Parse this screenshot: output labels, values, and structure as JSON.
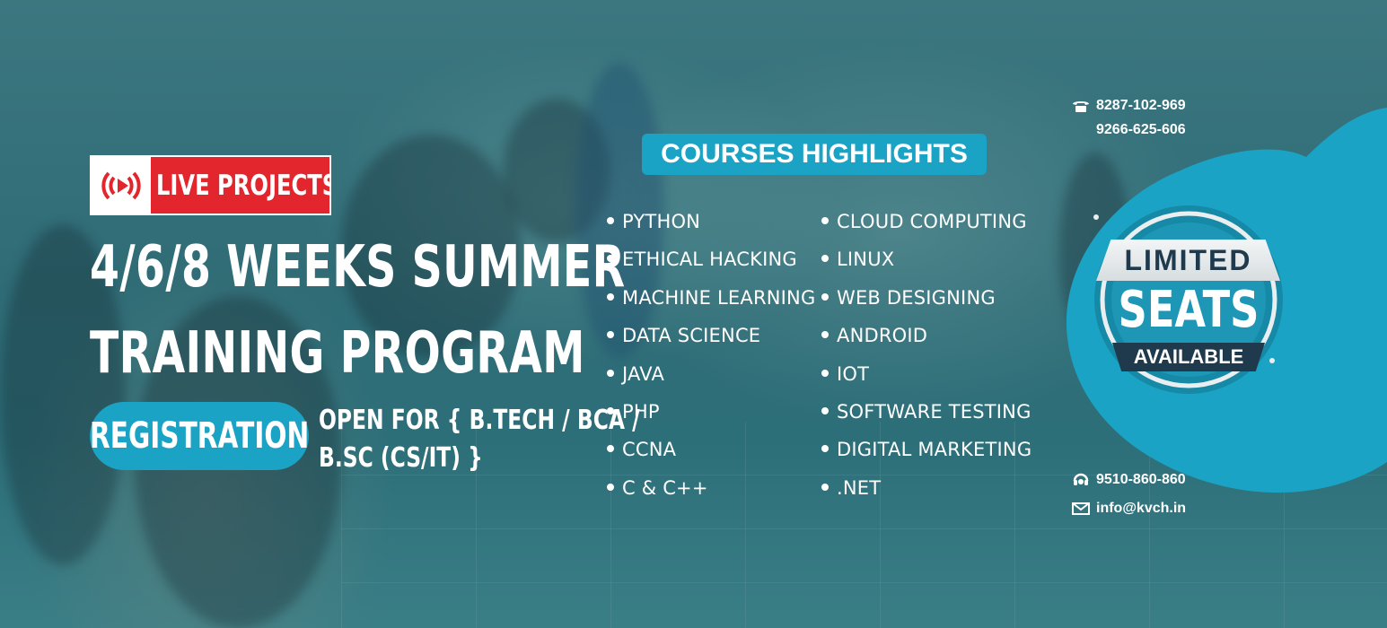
{
  "badge": {
    "label": "LIVE PROJECTS"
  },
  "headline": {
    "line1": "4/6/8 WEEKS SUMMER",
    "line2": "TRAINING PROGRAM"
  },
  "registration": {
    "label": "REGISTRATION"
  },
  "open_for": {
    "line1": "OPEN FOR { B.TECH / BCA /",
    "line2": "B.SC (CS/IT) }"
  },
  "courses": {
    "title": "COURSES HIGHLIGHTS",
    "left": [
      "PYTHON",
      "ETHICAL HACKING",
      "MACHINE LEARNING",
      "DATA SCIENCE",
      "JAVA",
      "PHP",
      "CCNA",
      "C & C++"
    ],
    "right": [
      "CLOUD COMPUTING",
      "LINUX",
      "WEB DESIGNING",
      "ANDROID",
      "IOT",
      "SOFTWARE TESTING",
      "DIGITAL MARKETING",
      ".NET"
    ]
  },
  "contact": {
    "phone1": "8287-102-969",
    "phone2": "9266-625-606",
    "support": "9510-860-860",
    "email": "info@kvch.in"
  },
  "seal": {
    "line1": "LIMITED",
    "line2": "SEATS",
    "line3": "AVAILABLE"
  },
  "colors": {
    "accent": "#1aa3c4",
    "badge_red": "#e3262d",
    "background": "#2c6a74"
  }
}
